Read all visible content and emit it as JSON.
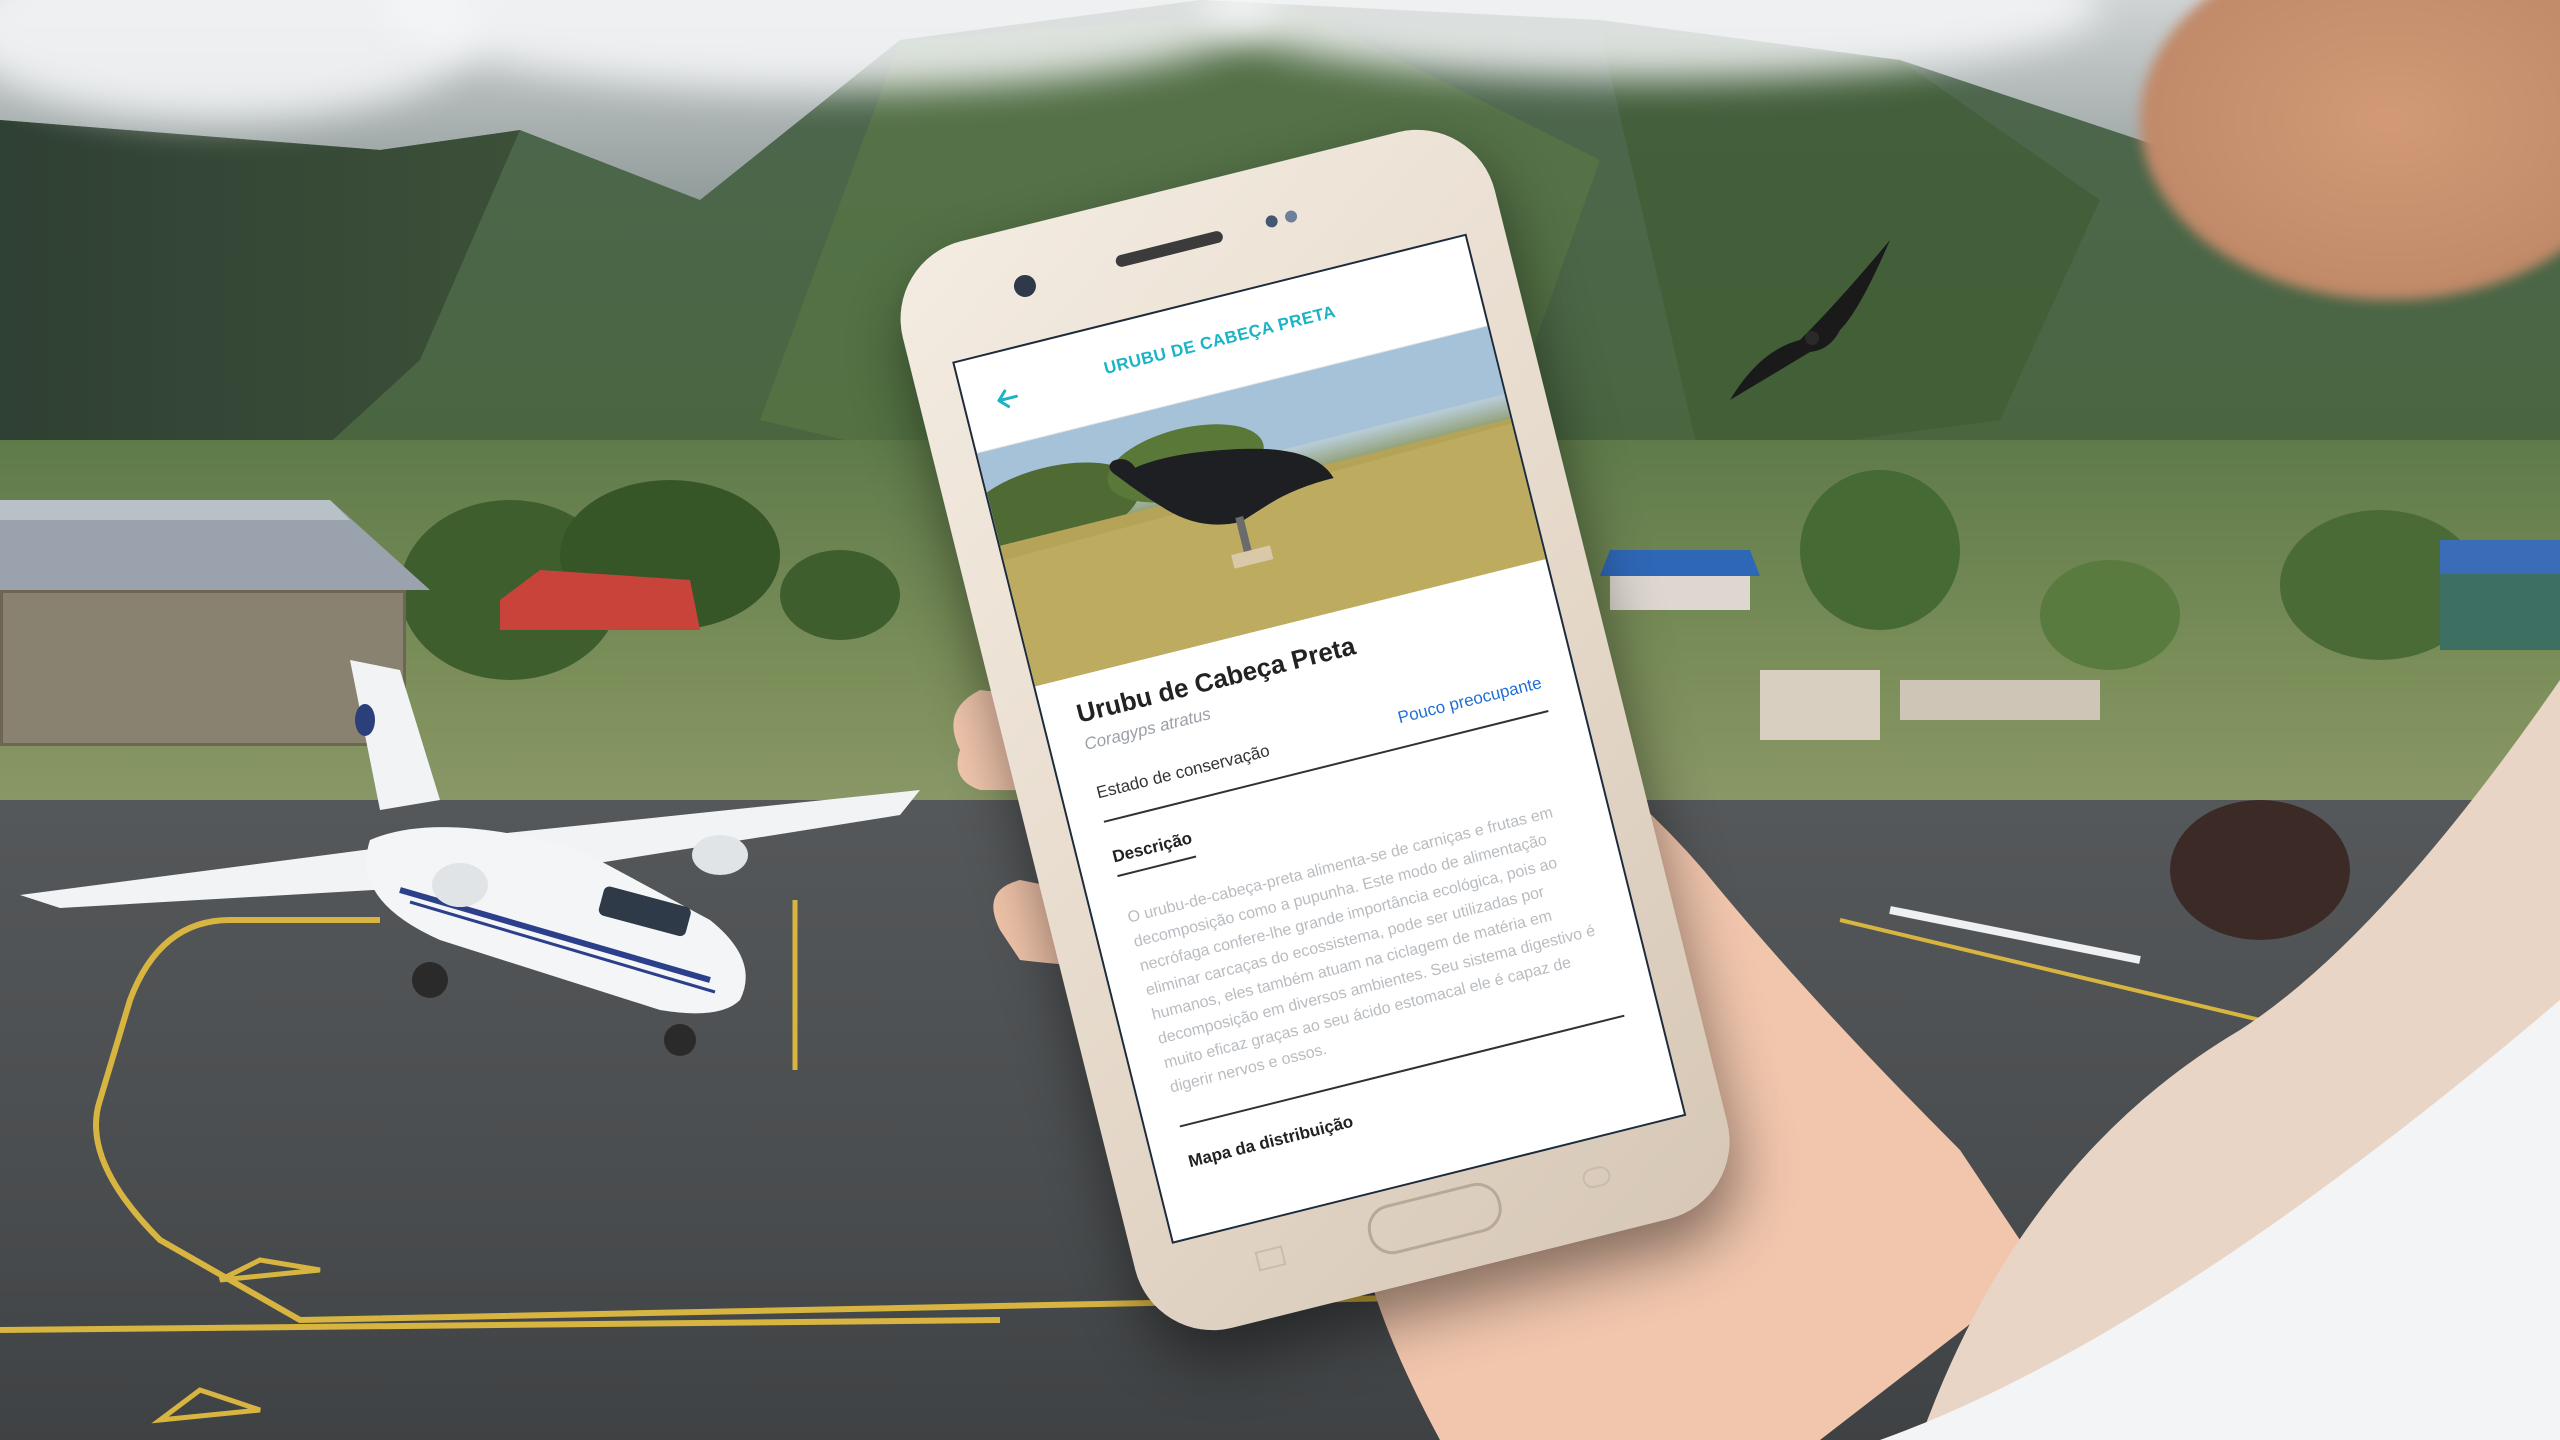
{
  "app": {
    "title": "URUBU DE CABEÇA PRETA"
  },
  "species": {
    "common_name": "Urubu de Cabeça Preta",
    "scientific_name": "Coragyps atratus",
    "conservation_label": "Estado de conservação",
    "conservation_value": "Pouco preocupante"
  },
  "sections": {
    "description_title": "Descrição",
    "description_text": "O urubu-de-cabeça-preta alimenta-se de carniças e frutas em decomposição como a pupunha. Este modo de alimentação necrófaga confere-lhe grande importância ecológica, pois ao eliminar carcaças do ecossistema, pode ser utilizadas por humanos, eles também atuam na ciclagem de matéria em decomposição em diversos ambientes. Seu sistema digestivo é muito eficaz graças ao seu ácido estomacal ele é capaz de digerir nervos e ossos.",
    "map_title": "Mapa da distribuição"
  },
  "icons": {
    "back": "back-arrow-icon"
  },
  "colors": {
    "accent": "#1bb3c6",
    "link": "#1f6fd6"
  }
}
